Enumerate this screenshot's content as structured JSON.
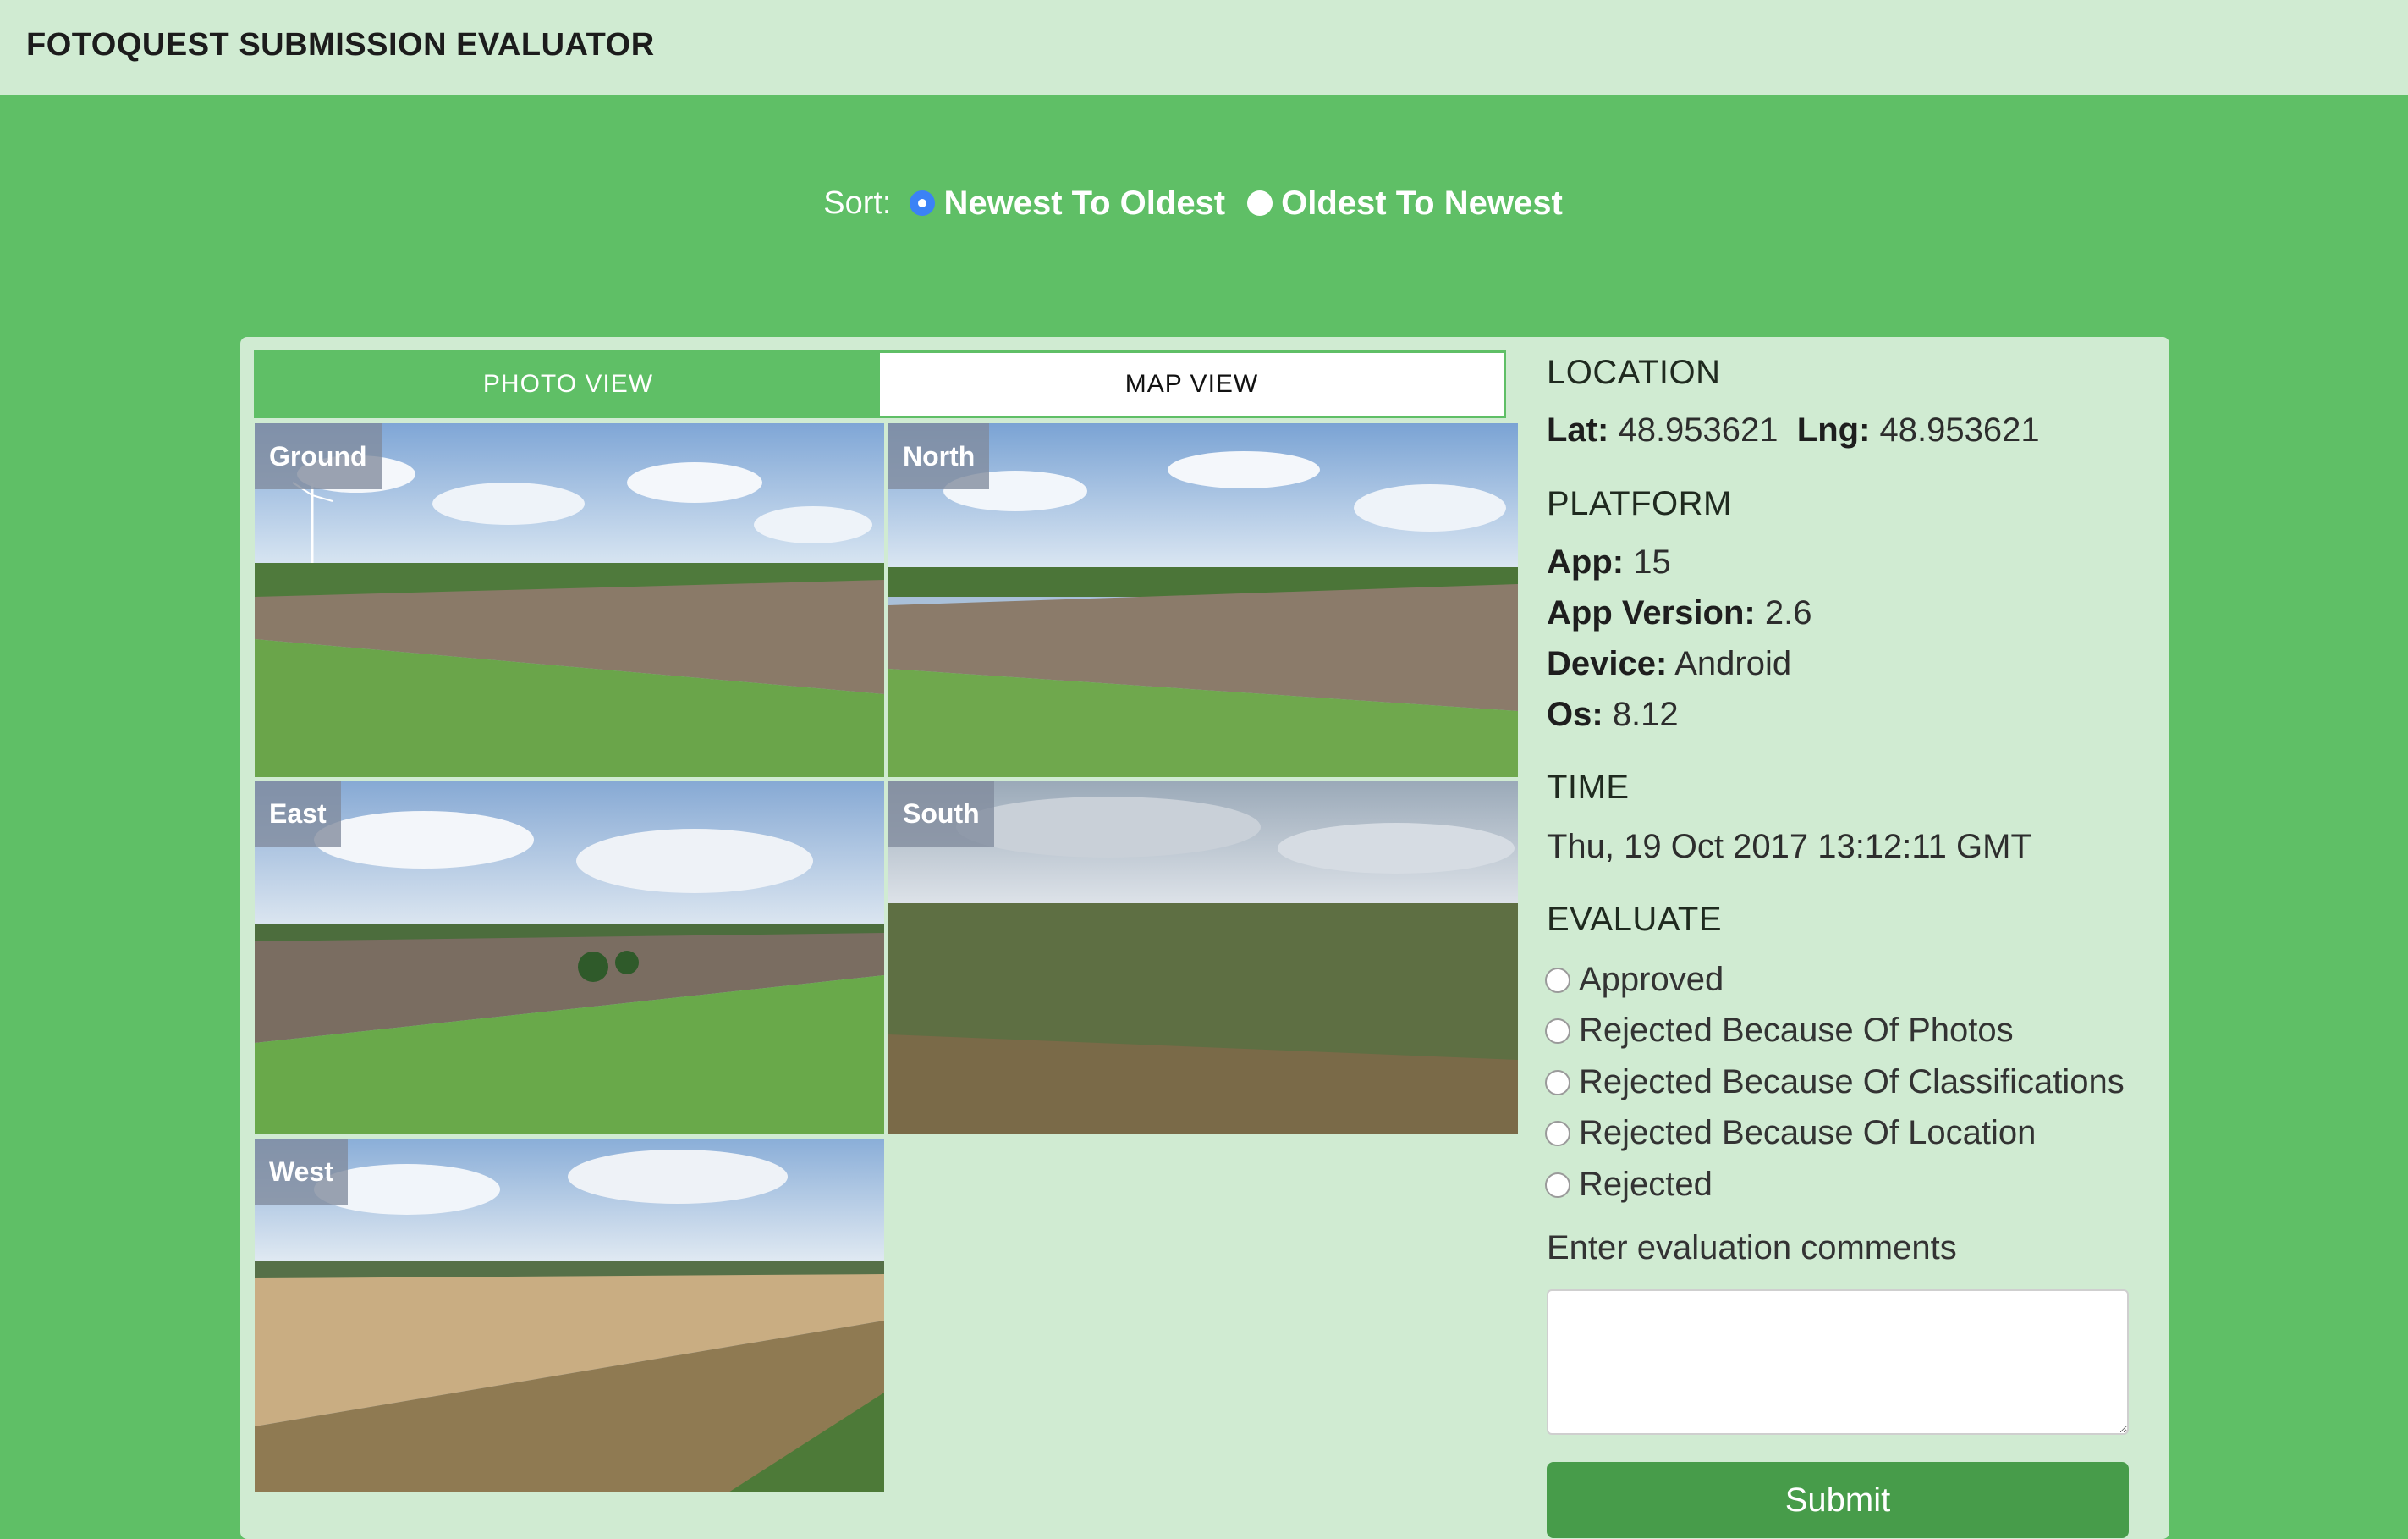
{
  "app": {
    "title": "FOTOQUEST SUBMISSION EVALUATOR"
  },
  "sort": {
    "label": "Sort:",
    "options": [
      {
        "label": "Newest To Oldest",
        "selected": true
      },
      {
        "label": "Oldest To Newest",
        "selected": false
      }
    ]
  },
  "tabs": [
    {
      "label": "PHOTO VIEW",
      "active": true
    },
    {
      "label": "MAP VIEW",
      "active": false
    }
  ],
  "photos": [
    {
      "label": "Ground"
    },
    {
      "label": "North"
    },
    {
      "label": "East"
    },
    {
      "label": "South"
    },
    {
      "label": "West"
    }
  ],
  "location": {
    "title": "LOCATION",
    "lat_label": "Lat:",
    "lat_value": "48.953621",
    "lng_label": "Lng:",
    "lng_value": "48.953621"
  },
  "platform": {
    "title": "PLATFORM",
    "app_label": "App:",
    "app_value": "15",
    "version_label": "App Version:",
    "version_value": "2.6",
    "device_label": "Device:",
    "device_value": "Android",
    "os_label": "Os:",
    "os_value": "8.12"
  },
  "time": {
    "title": "TIME",
    "value": "Thu, 19 Oct 2017 13:12:11 GMT"
  },
  "evaluate": {
    "title": "EVALUATE",
    "options": [
      "Approved",
      "Rejected Because Of Photos",
      "Rejected Because Of Classifications",
      "Rejected Because Of Location",
      "Rejected"
    ],
    "comments_label": "Enter evaluation comments",
    "comments_value": "",
    "submit_label": "Submit"
  },
  "colors": {
    "page_bg": "#5fbf66",
    "header_bg": "#d0ebd2",
    "panel_bg": "#d0ebd2",
    "accent": "#5fbf66",
    "submit_bg": "#479c4a",
    "radio_checked": "#3b82f6"
  }
}
